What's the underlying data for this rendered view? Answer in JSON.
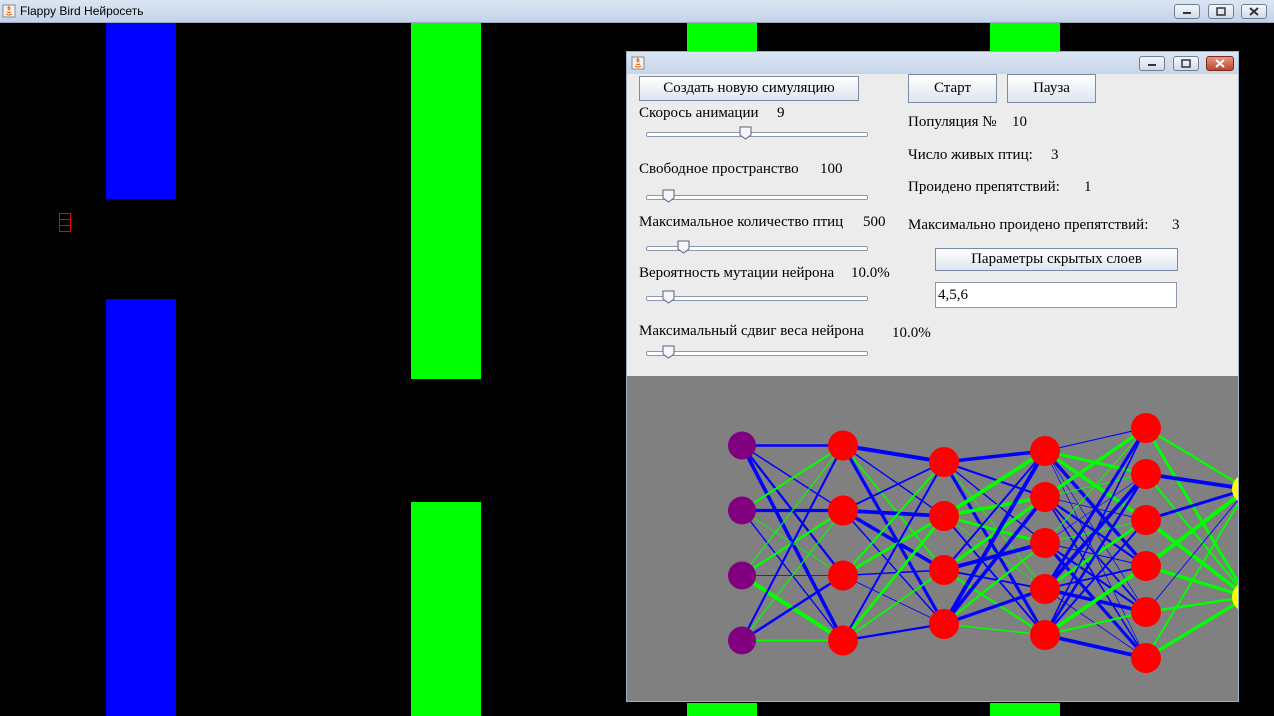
{
  "window": {
    "title": "Flappy Bird Нейросеть",
    "buttons": [
      "minimize",
      "maximize",
      "close"
    ]
  },
  "game": {
    "colors": {
      "background": "#000000",
      "pipe_blue": "#0000ff",
      "pipe_green": "#00ff00",
      "bird": "#ff0000"
    }
  },
  "controls": {
    "new_simulation": "Создать новую симуляцию",
    "start": "Старт",
    "pause": "Пауза",
    "hidden_layers_button": "Параметры скрытых слоев",
    "hidden_layers_value": "4,5,6",
    "sliders": [
      {
        "label": "Скорось анимации",
        "value": "9",
        "fraction": 0.45
      },
      {
        "label": "Свободное пространство",
        "value": "100",
        "fraction": 0.1
      },
      {
        "label": "Максимальное количество птиц",
        "value": "500",
        "fraction": 0.17
      },
      {
        "label": "Вероятность мутации нейрона",
        "value": "10.0%",
        "fraction": 0.1
      },
      {
        "label": "Максимальный сдвиг веса нейрона",
        "value": "10.0%",
        "fraction": 0.1
      }
    ]
  },
  "stats": {
    "population_label": "Популяция №",
    "population_value": "10",
    "alive_label": "Число живых птиц:",
    "alive_value": "3",
    "passed_label": "Проидено препятствий:",
    "passed_value": "1",
    "max_passed_label": "Максимально проидено препятствий:",
    "max_passed_value": "3"
  },
  "network": {
    "layers": [
      4,
      4,
      4,
      5,
      6,
      2
    ],
    "layer_roles": [
      "input",
      "hidden",
      "hidden",
      "hidden",
      "hidden",
      "output"
    ],
    "colors": {
      "background": "#808080",
      "input": "#800080",
      "hidden": "#ff0000",
      "output": "#ffff00",
      "positive": "#00ff00",
      "negative": "#0000ff"
    }
  }
}
